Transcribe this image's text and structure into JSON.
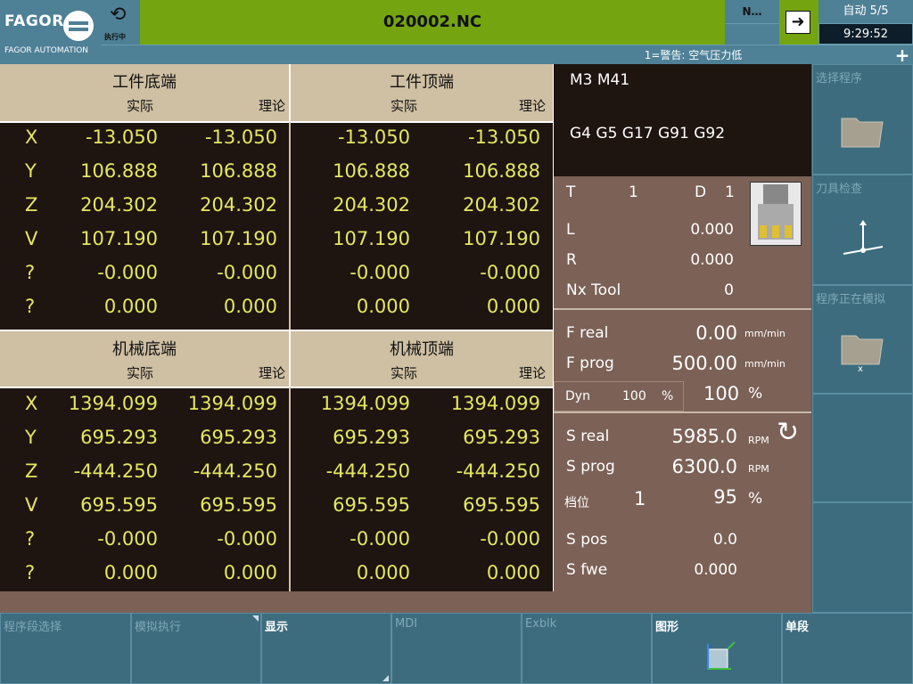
{
  "header": {
    "logo_text": "FAGOR",
    "logo_subtitle": "FAGOR AUTOMATION",
    "exec_label": "执行中",
    "program_name": "020002.NC",
    "n_label": "N…",
    "mode": "自动 5/5",
    "time": "9:29:52",
    "warning": "1=警告:  空气压力低",
    "plus": "+"
  },
  "part_panels": [
    {
      "title": "工件底端",
      "actual": "实际",
      "theory": "理论"
    },
    {
      "title": "工件顶端",
      "actual": "实际",
      "theory": "理论"
    }
  ],
  "machine_panels": [
    {
      "title": "机械底端",
      "actual": "实际",
      "theory": "理论"
    },
    {
      "title": "机械顶端",
      "actual": "实际",
      "theory": "理论"
    }
  ],
  "part_rows": [
    {
      "axis": "X",
      "b_act": "-13.050",
      "b_th": "-13.050",
      "t_act": "-13.050",
      "t_th": "-13.050"
    },
    {
      "axis": "Y",
      "b_act": "106.888",
      "b_th": "106.888",
      "t_act": "106.888",
      "t_th": "106.888"
    },
    {
      "axis": "Z",
      "b_act": "204.302",
      "b_th": "204.302",
      "t_act": "204.302",
      "t_th": "204.302"
    },
    {
      "axis": "V",
      "b_act": "107.190",
      "b_th": "107.190",
      "t_act": "107.190",
      "t_th": "107.190"
    },
    {
      "axis": "?",
      "b_act": "-0.000",
      "b_th": "-0.000",
      "t_act": "-0.000",
      "t_th": "-0.000"
    },
    {
      "axis": "?",
      "b_act": "0.000",
      "b_th": "0.000",
      "t_act": "0.000",
      "t_th": "0.000"
    }
  ],
  "machine_rows": [
    {
      "axis": "X",
      "b_act": "1394.099",
      "b_th": "1394.099",
      "t_act": "1394.099",
      "t_th": "1394.099"
    },
    {
      "axis": "Y",
      "b_act": "695.293",
      "b_th": "695.293",
      "t_act": "695.293",
      "t_th": "695.293"
    },
    {
      "axis": "Z",
      "b_act": "-444.250",
      "b_th": "-444.250",
      "t_act": "-444.250",
      "t_th": "-444.250"
    },
    {
      "axis": "V",
      "b_act": "695.595",
      "b_th": "695.595",
      "t_act": "695.595",
      "t_th": "695.595"
    },
    {
      "axis": "?",
      "b_act": "-0.000",
      "b_th": "-0.000",
      "t_act": "-0.000",
      "t_th": "-0.000"
    },
    {
      "axis": "?",
      "b_act": "0.000",
      "b_th": "0.000",
      "t_act": "0.000",
      "t_th": "0.000"
    }
  ],
  "codes": {
    "m": "M3 M41",
    "g": "G4 G5 G17 G91 G92"
  },
  "tool": {
    "t_label": "T",
    "t_val": "1",
    "d_label": "D",
    "d_val": "1",
    "l_label": "L",
    "l_val": "0.000",
    "r_label": "R",
    "r_val": "0.000",
    "nx_label": "Nx Tool",
    "nx_val": "0"
  },
  "feed": {
    "freal_label": "F real",
    "freal_val": "0.00",
    "freal_unit": "mm/min",
    "fprog_label": "F prog",
    "fprog_val": "500.00",
    "fprog_unit": "mm/min",
    "dyn_label": "Dyn",
    "dyn_val": "100",
    "dyn_unit": "%",
    "ovr_val": "100",
    "ovr_unit": "%"
  },
  "spindle": {
    "sreal_label": "S real",
    "sreal_val": "5985.0",
    "sreal_unit": "RPM",
    "sprog_label": "S prog",
    "sprog_val": "6300.0",
    "sprog_unit": "RPM",
    "gear_label": "档位",
    "gear_val": "1",
    "sovr_val": "95",
    "sovr_unit": "%",
    "spos_label": "S pos",
    "spos_val": "0.0",
    "sfwe_label": "S fwe",
    "sfwe_val": "0.000"
  },
  "side_keys": [
    "选择程序",
    "刀具检查",
    "程序正在模拟",
    "",
    ""
  ],
  "bottom_keys": [
    "程序段选择",
    "模拟执行",
    "显示",
    "MDI",
    "Exblk",
    "图形",
    "单段"
  ],
  "icons": {
    "logo": "fagor-logo-icon",
    "exec": "rotate-arrows-icon",
    "arrow": "right-arrow-box-icon",
    "tool_img": "milling-tool-icon",
    "spindle": "rotation-cw-icon",
    "select_prog": "folder-icon",
    "tool_check": "axis-tool-icon",
    "sim_prog": "folder-sim-icon",
    "graphics": "cube-axes-icon"
  }
}
